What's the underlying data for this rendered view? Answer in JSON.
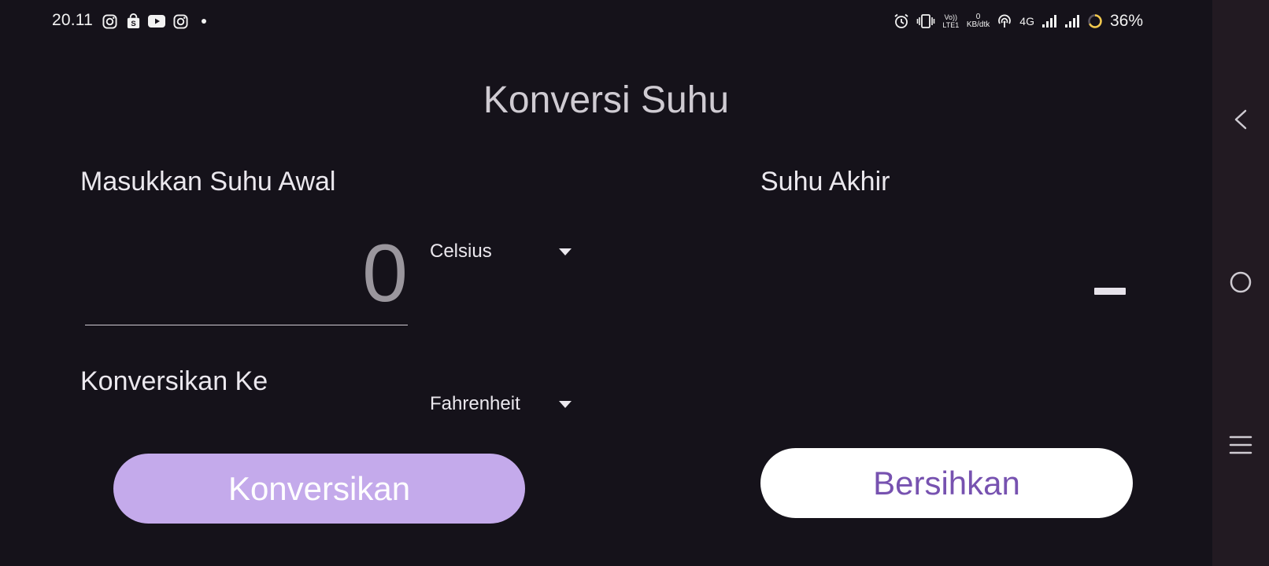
{
  "status_bar": {
    "time": "20.11",
    "left_icons": [
      "instagram-icon",
      "shopping-bag-icon",
      "youtube-icon",
      "instagram-icon",
      "dot-icon"
    ],
    "volte_text": "Vo)) LTE1",
    "speed_value": "0",
    "speed_unit": "KB/dtk",
    "network_type": "4G",
    "battery_percent": "36%",
    "battery_ring_color": "#f2c94c"
  },
  "app": {
    "title": "Konversi Suhu",
    "input_section_label": "Masukkan Suhu Awal",
    "input_placeholder": "0",
    "input_value": "",
    "from_unit": "Celsius",
    "convert_to_label": "Konversikan Ke",
    "to_unit": "Fahrenheit",
    "result_label": "Suhu Akhir",
    "result_value": "-",
    "convert_button": "Konversikan",
    "clear_button": "Bersihkan"
  },
  "navigation": {
    "buttons": [
      "back-icon",
      "home-icon",
      "recents-icon"
    ]
  },
  "colors": {
    "background": "#15121a",
    "convert_button_bg": "#c4aaeb",
    "clear_button_text": "#7752b0",
    "nav_bar_bg": "#221a22"
  }
}
